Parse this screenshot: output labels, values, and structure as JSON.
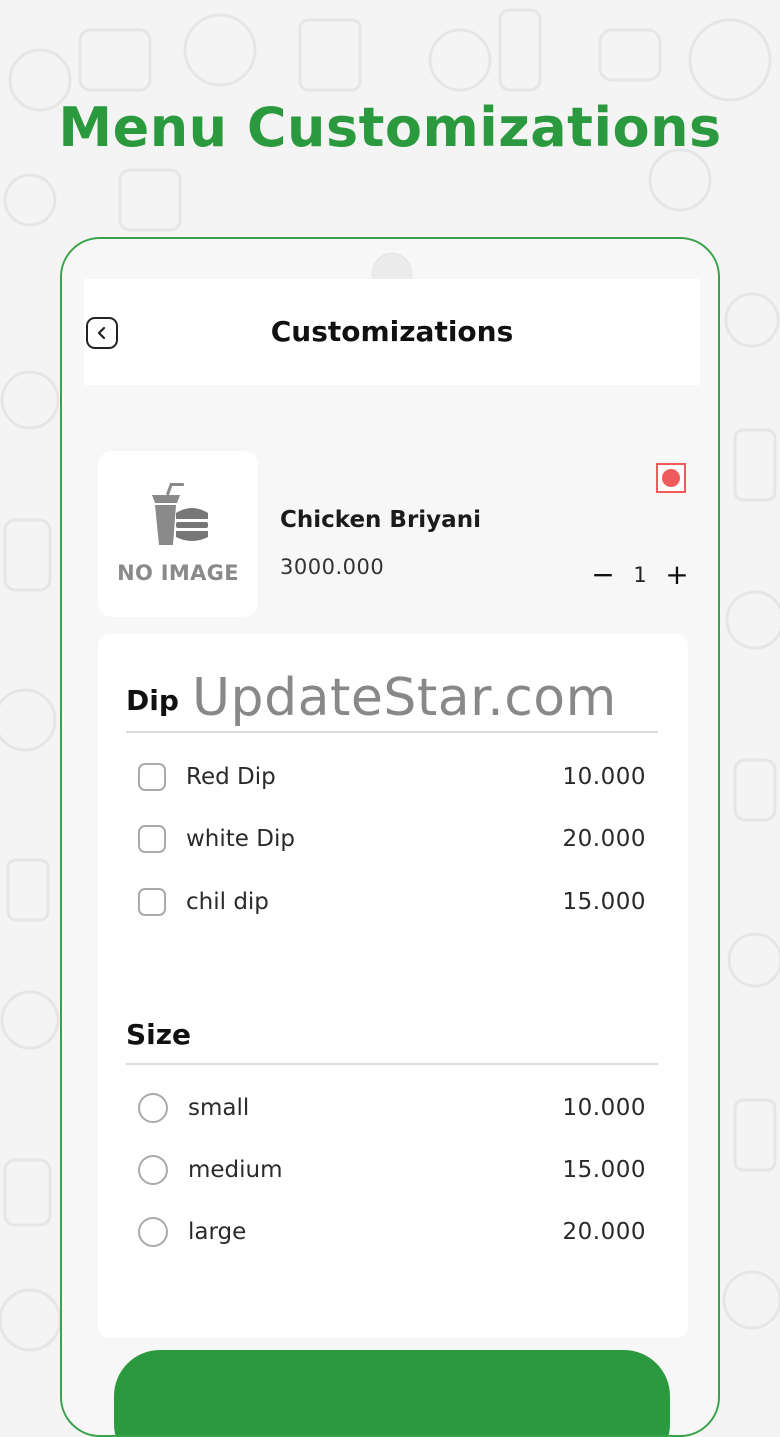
{
  "headline": "Menu Customizations",
  "appbar": {
    "title": "Customizations"
  },
  "product": {
    "image_placeholder": "NO IMAGE",
    "name": "Chicken Briyani",
    "price": "3000.000",
    "quantity": "1",
    "qty_minus": "−",
    "qty_plus": "+"
  },
  "groups": {
    "dip": {
      "title": "Dip",
      "options": [
        {
          "label": "Red Dip",
          "price": "10.000"
        },
        {
          "label": "white Dip",
          "price": "20.000"
        },
        {
          "label": "chil dip",
          "price": "15.000"
        }
      ]
    },
    "size": {
      "title": "Size",
      "options": [
        {
          "label": "small",
          "price": "10.000"
        },
        {
          "label": "medium",
          "price": "15.000"
        },
        {
          "label": "large",
          "price": "20.000"
        }
      ]
    }
  },
  "watermark": "UpdateStar.com",
  "colors": {
    "brand_green": "#2b9a3e",
    "veg_mark_red": "#ef5a5a"
  }
}
